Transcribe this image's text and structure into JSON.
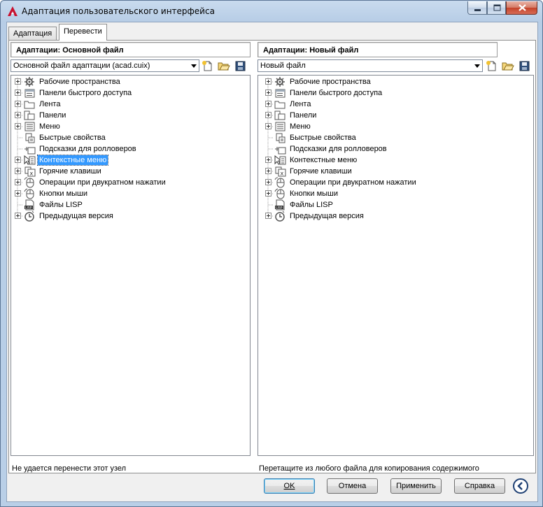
{
  "window": {
    "title": "Адаптация пользовательского интерфейса"
  },
  "tabs": [
    {
      "label": "Адаптация"
    },
    {
      "label": "Перевести"
    }
  ],
  "left": {
    "header": "Адаптации: Основной файл",
    "combo_value": "Основной файл адаптации (acad.cuix)",
    "status": "Не удается перенести этот узел",
    "items": [
      {
        "label": "Рабочие пространства",
        "icon": "workspaces-icon"
      },
      {
        "label": "Панели быстрого доступа",
        "icon": "quick-access-toolbar-icon"
      },
      {
        "label": "Лента",
        "icon": "ribbon-icon"
      },
      {
        "label": "Панели",
        "icon": "toolbars-icon"
      },
      {
        "label": "Меню",
        "icon": "menu-icon"
      },
      {
        "label": "Быстрые свойства",
        "icon": "quick-properties-icon"
      },
      {
        "label": "Подсказки для ролловеров",
        "icon": "rollover-tooltips-icon"
      },
      {
        "label": "Контекстные меню",
        "icon": "shortcut-menus-icon"
      },
      {
        "label": "Горячие клавиши",
        "icon": "keyboard-shortcuts-icon"
      },
      {
        "label": "Операции при двукратном нажатии",
        "icon": "double-click-actions-icon"
      },
      {
        "label": "Кнопки мыши",
        "icon": "mouse-buttons-icon"
      },
      {
        "label": "Файлы LISP",
        "icon": "lisp-files-icon"
      },
      {
        "label": "Предыдущая версия",
        "icon": "legacy-icon"
      }
    ]
  },
  "right": {
    "header": "Адаптации: Новый файл",
    "combo_value": "Новый файл",
    "status": "Перетащите из любого файла для копирования содержимого",
    "items": [
      {
        "label": "Рабочие пространства",
        "icon": "workspaces-icon"
      },
      {
        "label": "Панели быстрого доступа",
        "icon": "quick-access-toolbar-icon"
      },
      {
        "label": "Лента",
        "icon": "ribbon-icon"
      },
      {
        "label": "Панели",
        "icon": "toolbars-icon"
      },
      {
        "label": "Меню",
        "icon": "menu-icon"
      },
      {
        "label": "Быстрые свойства",
        "icon": "quick-properties-icon"
      },
      {
        "label": "Подсказки для ролловеров",
        "icon": "rollover-tooltips-icon"
      },
      {
        "label": "Контекстные меню",
        "icon": "shortcut-menus-icon"
      },
      {
        "label": "Горячие клавиши",
        "icon": "keyboard-shortcuts-icon"
      },
      {
        "label": "Операции при двукратном нажатии",
        "icon": "double-click-actions-icon"
      },
      {
        "label": "Кнопки мыши",
        "icon": "mouse-buttons-icon"
      },
      {
        "label": "Файлы LISP",
        "icon": "lisp-files-icon"
      },
      {
        "label": "Предыдущая версия",
        "icon": "legacy-icon"
      }
    ]
  },
  "buttons": {
    "ok": "OK",
    "cancel": "Отмена",
    "apply": "Применить",
    "help": "Справка"
  },
  "colors": {
    "selection": "#3399ff",
    "autocad_red": "#c8102e"
  }
}
